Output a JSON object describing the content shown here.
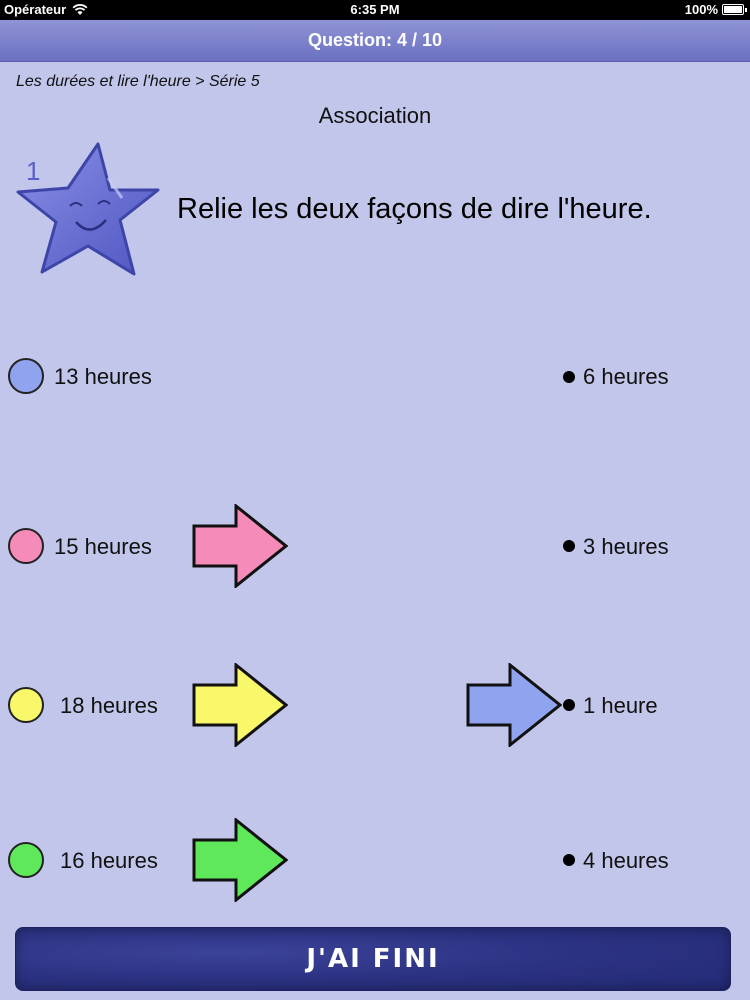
{
  "status_bar": {
    "carrier": "Opérateur",
    "time": "6:35 PM",
    "battery": "100%",
    "wifi_icon": "wifi-icon",
    "battery_icon": "battery-icon"
  },
  "nav": {
    "title": "Question: 4 / 10"
  },
  "breadcrumb": "Les durées et lire l'heure > Série 5",
  "section_title": "Association",
  "star": {
    "number": "1",
    "icon": "smiling-star-icon",
    "color": "#6a70d4"
  },
  "instruction": "Relie les deux façons de dire l'heure.",
  "left_items": [
    {
      "label": "13 heures",
      "color": "#8fa3ee",
      "has_arrow": false
    },
    {
      "label": "15 heures",
      "color": "#f48bb8",
      "has_arrow": true
    },
    {
      "label": "18 heures",
      "color": "#f8f86a",
      "has_arrow": true
    },
    {
      "label": "16 heures",
      "color": "#5ee85a",
      "has_arrow": true
    }
  ],
  "right_items": [
    {
      "label": "6 heures",
      "has_arrow": false
    },
    {
      "label": "3 heures",
      "has_arrow": false
    },
    {
      "label": "1 heure",
      "has_arrow": true,
      "arrow_color": "#8fa3ee"
    },
    {
      "label": "4 heures",
      "has_arrow": false
    }
  ],
  "finish_button": "J'AI FINI"
}
